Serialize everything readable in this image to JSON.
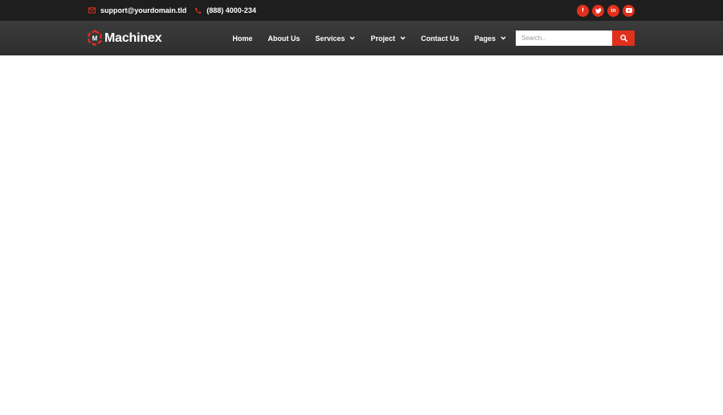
{
  "topbar": {
    "email": "support@yourdomain.tld",
    "phone": "(888) 4000-234",
    "socials": [
      {
        "icon": "facebook-icon",
        "glyph": "f"
      },
      {
        "icon": "twitter-icon",
        "glyph": ""
      },
      {
        "icon": "linkedin-icon",
        "glyph": "in"
      },
      {
        "icon": "youtube-icon",
        "glyph": ""
      }
    ]
  },
  "navbar": {
    "logo_text": "Machinex",
    "menu": [
      {
        "label": "Home",
        "has_dropdown": false
      },
      {
        "label": "About Us",
        "has_dropdown": false
      },
      {
        "label": "Services",
        "has_dropdown": true
      },
      {
        "label": "Project",
        "has_dropdown": true
      },
      {
        "label": "Contact Us",
        "has_dropdown": false
      },
      {
        "label": "Pages",
        "has_dropdown": true
      }
    ],
    "search": {
      "placeholder": "Search.."
    }
  },
  "colors": {
    "accent": "#e0311d",
    "topbar_bg": "#1e1e1e",
    "navbar_bg": "#353535"
  }
}
